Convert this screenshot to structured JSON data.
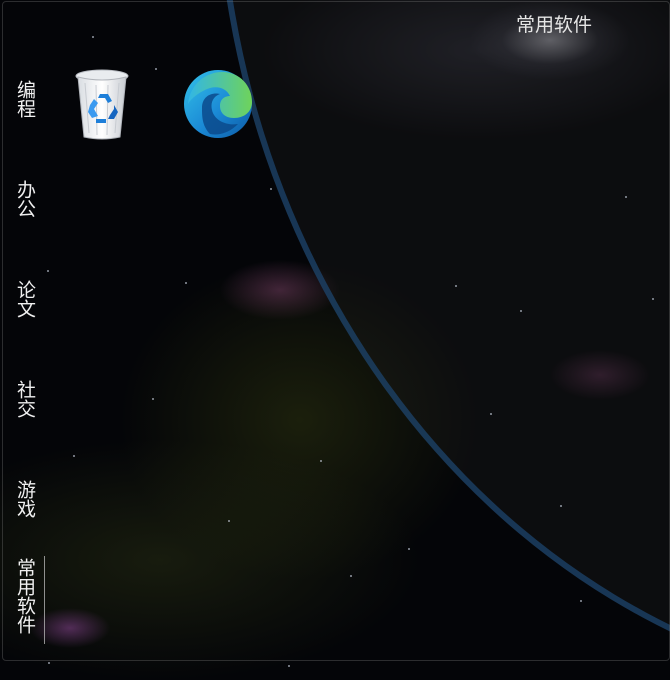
{
  "window": {
    "title": "常用软件"
  },
  "sidebar": {
    "items": [
      {
        "label": "编程"
      },
      {
        "label": "办公"
      },
      {
        "label": "论文"
      },
      {
        "label": "社交"
      },
      {
        "label": "游戏"
      },
      {
        "label": "常用软件",
        "active": true
      }
    ]
  },
  "desktop_icons": [
    {
      "name": "recycle-bin-icon"
    },
    {
      "name": "edge-browser-icon"
    }
  ],
  "colors": {
    "text": "#f0f0f0",
    "background": "#040508",
    "planet_rim": "#1e466e"
  }
}
